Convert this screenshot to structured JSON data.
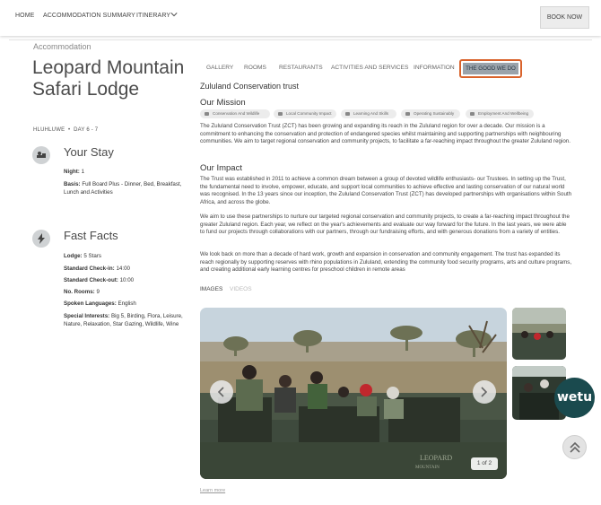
{
  "nav": {
    "home": "HOME",
    "summary": "ACCOMMODATION SUMMARY",
    "itinerary": "ITINERARY",
    "book": "BOOK NOW"
  },
  "breadcrumb": "Accommodation",
  "lodge": {
    "title": "Leopard Mountain Safari Lodge",
    "location": "HLUHLUWE",
    "days": "DAY 6 - 7"
  },
  "stay": {
    "title": "Your Stay",
    "night_label": "Night:",
    "night_value": "1",
    "basis_label": "Basis:",
    "basis_value": "Full Board Plus - Dinner, Bed, Breakfast, Lunch and Activities"
  },
  "facts": {
    "title": "Fast Facts",
    "items": [
      {
        "label": "Lodge:",
        "value": "5 Stars"
      },
      {
        "label": "Standard Check-in:",
        "value": "14:00"
      },
      {
        "label": "Standard Check-out:",
        "value": "10:00"
      },
      {
        "label": "No. Rooms:",
        "value": "9"
      },
      {
        "label": "Spoken Languages:",
        "value": "English"
      },
      {
        "label": "Special Interests:",
        "value": "Big 5, Birding, Flora, Leisure, Nature, Relaxation, Star Gazing, Wildlife, Wine"
      }
    ]
  },
  "tabs": [
    "GALLERY",
    "ROOMS",
    "RESTAURANTS",
    "ACTIVITIES AND SERVICES",
    "INFORMATION",
    "THE GOOD WE DO"
  ],
  "content": {
    "org": "Zululand Conservation trust",
    "mission_title": "Our Mission",
    "pills": [
      "Conservation And Wildlife",
      "Local Community Impact",
      "Learning And Skills",
      "Operating Sustainably",
      "Employment And Wellbeing"
    ],
    "mission_text": "The Zululand Conservation Trust (ZCT) has been growing and expanding its reach in the Zululand region for over a decade. Our mission is a commitment to enhancing the conservation and protection of endangered species whilst maintaining and supporting partnerships with neighbouring communities. We aim to target regional conservation and community projects, to facilitate a far-reaching impact throughout the greater Zululand region.",
    "impact_title": "Our Impact",
    "impact_p1": "The Trust was established in 2011 to achieve a common dream between a group of devoted wildlife enthusiasts- our Trustees. In setting up the Trust, the fundamental need to involve, empower, educate, and support local communities to achieve effective and lasting conservation of our natural world was recognised. In the 13 years since our inception, the Zululand Conservation Trust (ZCT) has developed partnerships with organisations within South Africa, and across the globe.",
    "impact_p2": "We aim to use these partnerships to nurture our targeted regional conservation and community projects, to create a far-reaching impact throughout the greater Zululand region. Each year, we reflect on the year's achievements and evaluate our way forward for the future. In the last years, we were able to fund our projects through collaborations with our partners, through our fundraising efforts, and with generous donations from a variety of entities.",
    "impact_p3": "We look back on more than a decade of hard work, growth and expansion in conservation and community engagement. The trust has expanded its reach regionally by supporting reserves with rhino populations in Zululand, extending the community food security programs, arts and culture programs, and creating additional early learning centres for preschool children in remote areas"
  },
  "media": {
    "images_tab": "IMAGES",
    "videos_tab": "VIDEOS",
    "counter": "1 of 2",
    "vehicle_text": "LEOPARD MOUNTAIN",
    "learn_more": "Learn more"
  },
  "widget": {
    "label": "wetu"
  },
  "colors": {
    "accent_border": "#d9622b",
    "active_tab_bg": "#9aa3ab",
    "wetu_bg": "#1a4a4e"
  }
}
